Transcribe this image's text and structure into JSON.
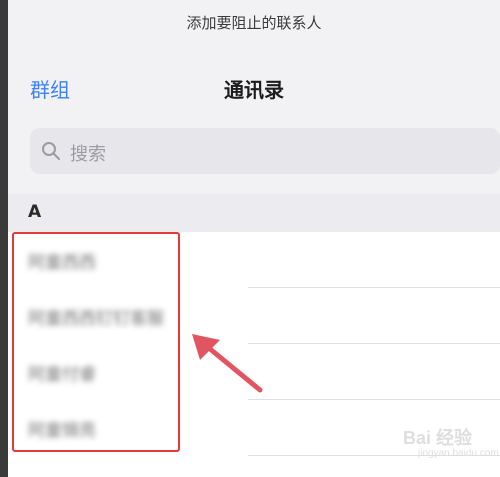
{
  "header": {
    "prompt": "添加要阻止的联系人",
    "nav_left": "群组",
    "nav_title": "通讯录"
  },
  "search": {
    "placeholder": "搜索",
    "icon": "search-icon"
  },
  "section": {
    "letter": "A"
  },
  "contacts": [
    {
      "name": "阿童西西"
    },
    {
      "name": "阿童西西钉钉客服"
    },
    {
      "name": "阿童付睿"
    },
    {
      "name": "阿童锦亮"
    }
  ],
  "annotation": {
    "highlight_color": "#e53935",
    "arrow_color": "#e05561"
  },
  "watermark": {
    "text": "Bai 经验",
    "sub": "jingyan.baidu.com"
  },
  "colors": {
    "accent": "#3e82f7",
    "background": "#f2f2f4"
  }
}
